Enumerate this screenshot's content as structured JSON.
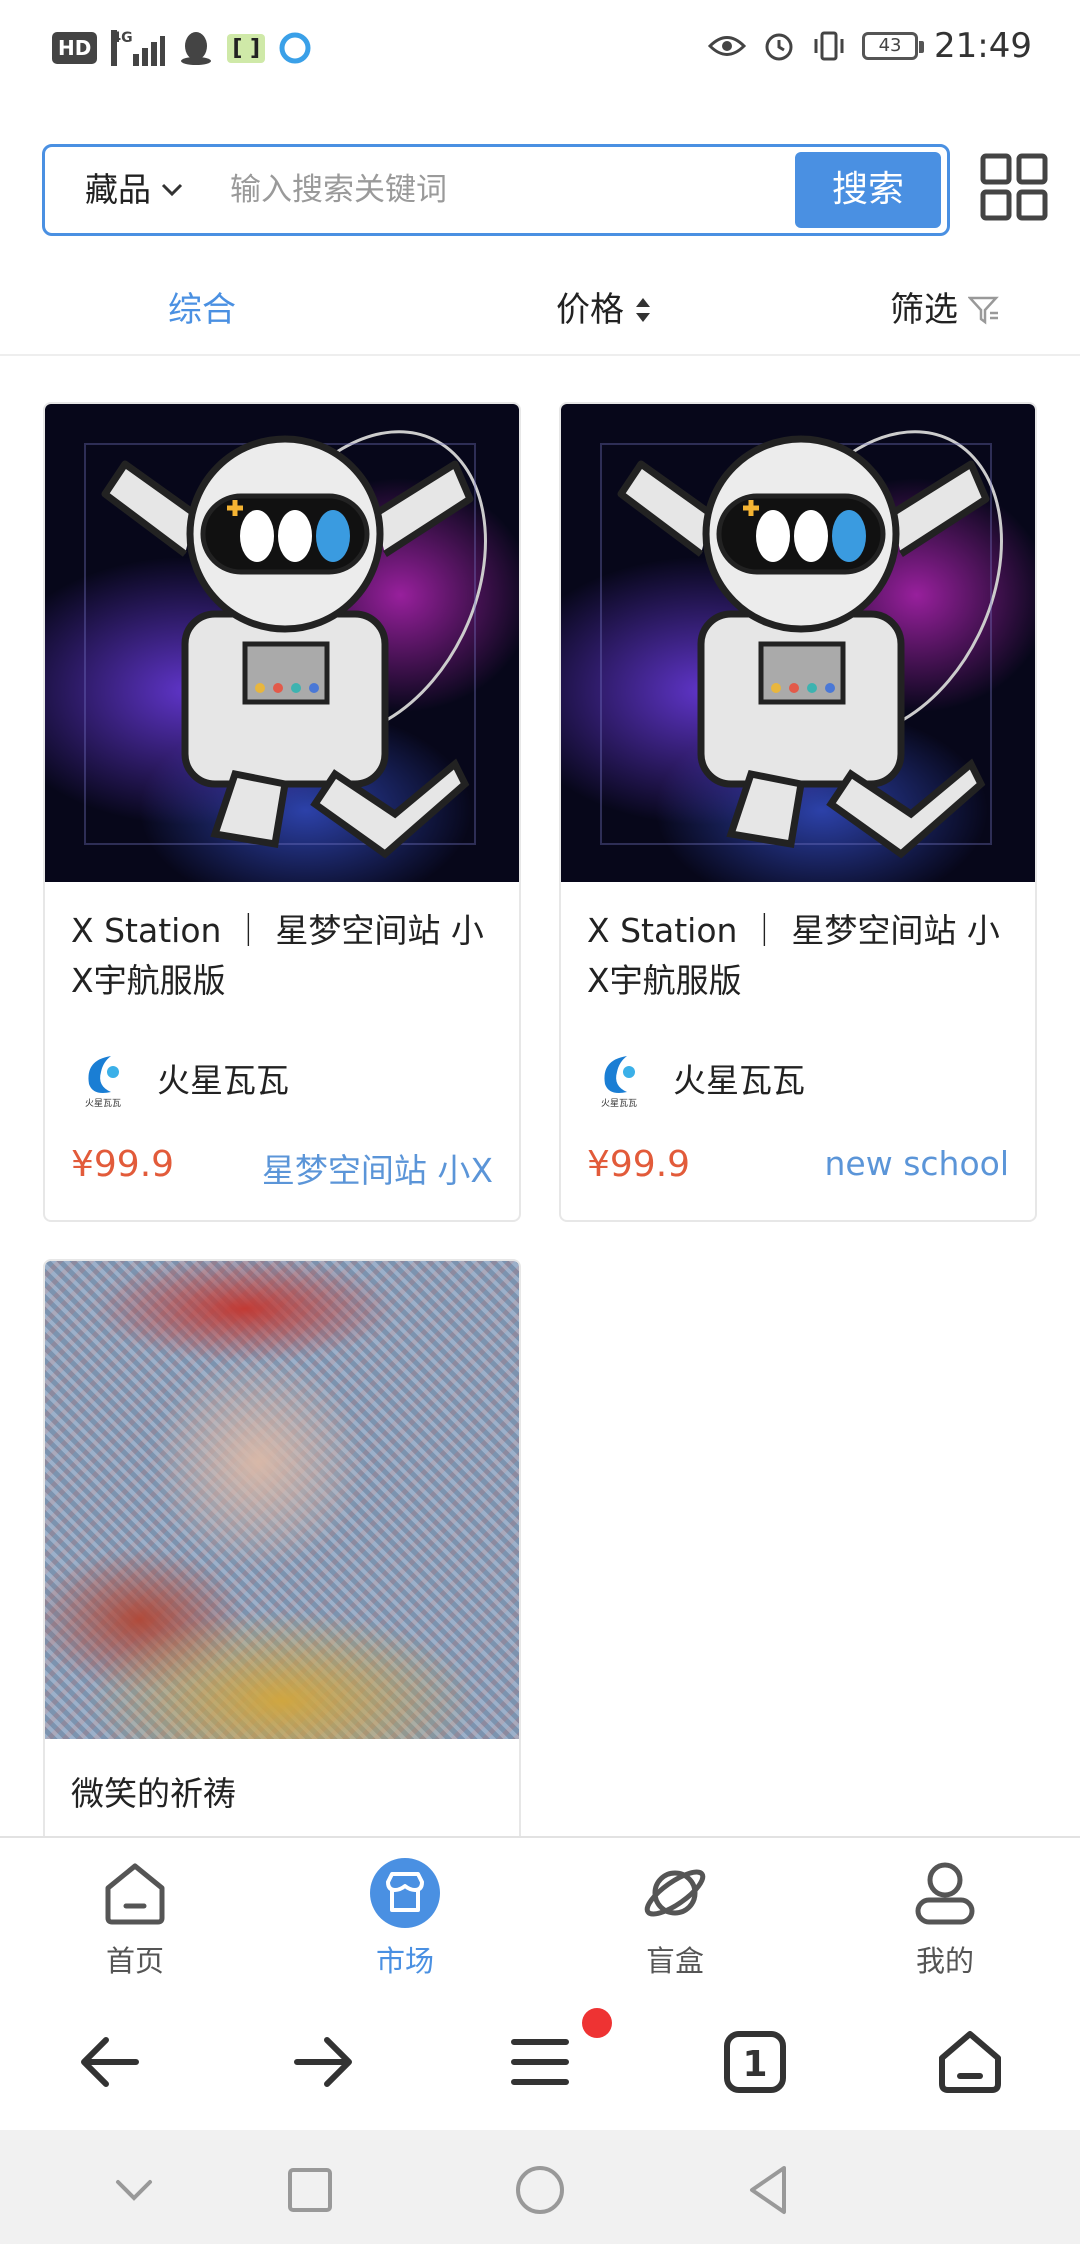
{
  "status_bar": {
    "hd": "HD",
    "network": "4G",
    "sim_icon_text": "[ ]",
    "battery": "43",
    "time": "21:49"
  },
  "search": {
    "category": "藏品",
    "placeholder": "输入搜索关键词",
    "button_label": "搜索"
  },
  "sort_bar": {
    "comprehensive": "综合",
    "price": "价格",
    "filter": "筛选"
  },
  "products": [
    {
      "title": "X Station ｜ 星梦空间站 小X宇航服版",
      "creator": "火星瓦瓦",
      "price": "¥99.9",
      "series": "星梦空间站 小X",
      "art": "astronaut"
    },
    {
      "title": "X Station ｜ 星梦空间站 小X宇航服版",
      "creator": "火星瓦瓦",
      "price": "¥99.9",
      "series": "new school",
      "art": "astronaut"
    },
    {
      "title": "微笑的祈祷",
      "art": "portrait-mosaic"
    }
  ],
  "tab_bar": {
    "home": "首页",
    "market": "市场",
    "blind_box": "盲盒",
    "mine": "我的"
  },
  "colors": {
    "accent": "#4a90e2",
    "price": "#e25b3a",
    "series": "#5b95d8"
  }
}
